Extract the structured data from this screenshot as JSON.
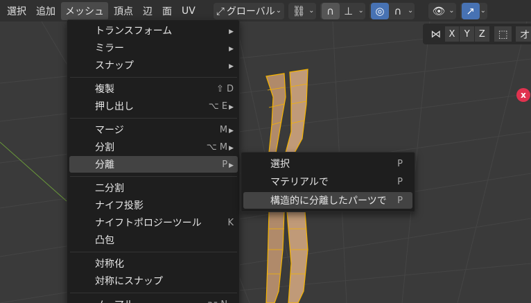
{
  "header": {
    "menus": [
      {
        "label": "選択",
        "active": false
      },
      {
        "label": "追加",
        "active": false
      },
      {
        "label": "メッシュ",
        "active": true
      },
      {
        "label": "頂点",
        "active": false
      },
      {
        "label": "辺",
        "active": false
      },
      {
        "label": "面",
        "active": false
      },
      {
        "label": "UV",
        "active": false
      }
    ],
    "orientation": {
      "icon": "transform-orientation-icon",
      "label": "グローバル"
    },
    "icons": [
      "link-icon",
      "snap-magnet-icon",
      "snap-increment-icon",
      "proportional-editing-icon",
      "falloff-curve-icon",
      "visibility-eye-icon",
      "gizmo-icon"
    ]
  },
  "axis_bar": {
    "icon": "mirror-butterfly-icon",
    "axes": [
      "X",
      "Y",
      "Z"
    ],
    "trailing": "オ"
  },
  "mesh_menu": {
    "items": [
      {
        "label": "トランスフォーム",
        "shortcut": "",
        "submenu": true
      },
      {
        "label": "ミラー",
        "shortcut": "",
        "submenu": true
      },
      {
        "label": "スナップ",
        "shortcut": "",
        "submenu": true
      },
      {
        "label": "複製",
        "shortcut": "⇧ D",
        "submenu": false
      },
      {
        "label": "押し出し",
        "shortcut": "⌥ E",
        "submenu": true
      },
      {
        "label": "マージ",
        "shortcut": "M",
        "submenu": true
      },
      {
        "label": "分割",
        "shortcut": "⌥ M",
        "submenu": true
      },
      {
        "label": "分離",
        "shortcut": "P",
        "submenu": true,
        "highlighted": true
      },
      {
        "label": "二分割",
        "shortcut": "",
        "submenu": false
      },
      {
        "label": "ナイフ投影",
        "shortcut": "",
        "submenu": false
      },
      {
        "label": "ナイフトポロジーツール",
        "shortcut": "K",
        "submenu": false
      },
      {
        "label": "凸包",
        "shortcut": "",
        "submenu": false
      },
      {
        "label": "対称化",
        "shortcut": "",
        "submenu": false
      },
      {
        "label": "対称にスナップ",
        "shortcut": "",
        "submenu": false
      },
      {
        "label": "ノーマル",
        "shortcut": "⌥ N",
        "submenu": true
      }
    ]
  },
  "separate_submenu": {
    "items": [
      {
        "label": "選択",
        "shortcut": "P"
      },
      {
        "label": "マテリアルで",
        "shortcut": "P"
      },
      {
        "label": "構造的に分離したパーツで",
        "shortcut": "P",
        "highlighted": true
      }
    ]
  },
  "colors": {
    "header_bg": "#303030",
    "menu_bg": "#1e1e1e",
    "highlight": "#434343",
    "accent_blue": "#4772b3",
    "close_red": "#e0324f",
    "mesh_wire": "#f5b400"
  }
}
